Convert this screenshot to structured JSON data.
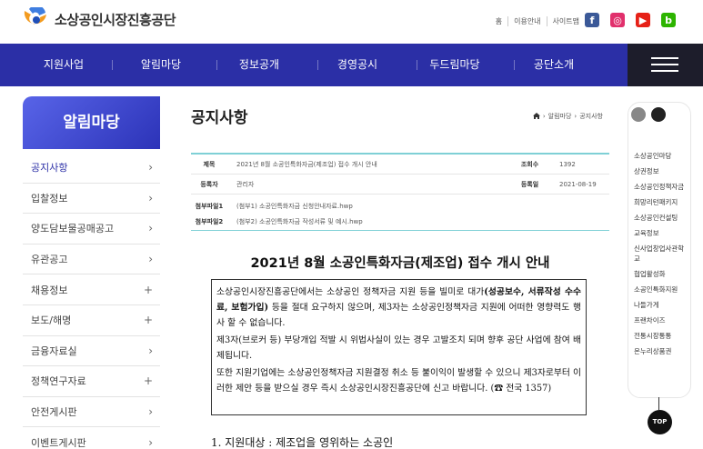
{
  "header": {
    "org_name": "소상공인시장진흥공단",
    "utils": [
      "홈",
      "이용안내",
      "사이트맵"
    ],
    "sns": [
      {
        "name": "facebook",
        "color": "#3b5998",
        "glyph": "f"
      },
      {
        "name": "instagram",
        "color": "#e1306c",
        "glyph": "◎"
      },
      {
        "name": "youtube",
        "color": "#e62117",
        "glyph": "▶"
      },
      {
        "name": "blog",
        "color": "#2db400",
        "glyph": "b"
      }
    ]
  },
  "gnb": {
    "items": [
      "지원사업",
      "알림마당",
      "정보공개",
      "경영공시",
      "두드림마당",
      "공단소개"
    ],
    "menu_icon": "hamburger-icon"
  },
  "lnb": {
    "title": "알림마당",
    "items": [
      {
        "label": "공지사항",
        "mark": "›",
        "active": true
      },
      {
        "label": "입찰정보",
        "mark": "›"
      },
      {
        "label": "양도담보물공매공고",
        "mark": "›"
      },
      {
        "label": "유관공고",
        "mark": "›"
      },
      {
        "label": "채용정보",
        "mark": "+"
      },
      {
        "label": "보도/해명",
        "mark": "+"
      },
      {
        "label": "금융자료실",
        "mark": "›"
      },
      {
        "label": "정책연구자료",
        "mark": "+"
      },
      {
        "label": "안전게시판",
        "mark": "›"
      },
      {
        "label": "이벤트게시판",
        "mark": "›"
      }
    ]
  },
  "main": {
    "page_title": "공지사항",
    "breadcrumb": [
      "알림마당",
      "공지사항"
    ],
    "post": {
      "subject_label": "제목",
      "subject": "2021년 8월 소공인특화자금(제조업) 접수 개시 안내",
      "views_label": "조회수",
      "views": "1392",
      "author_label": "등록자",
      "author": "관리자",
      "date_label": "등록일",
      "date": "2021-08-19",
      "files": [
        {
          "label": "첨부파일1",
          "name": "(첨부1) 소공인특화자금 신청안내자료.hwp"
        },
        {
          "label": "첨부파일2",
          "name": "(첨부2) 소공인특화자금 작성서류 및 예시.hwp"
        }
      ]
    },
    "doc_title": "2021년 8월 소공인특화자금(제조업) 접수 개시 안내",
    "notice": {
      "p1_a": "소상공인시장진흥공단에서는 소상공인 정책자금 지원 등을 빌미로 대가",
      "p1_b": "(성공보수, 서류작성 수수료, 보험가입)",
      "p1_c": " 등을 절대 요구하지 않으며, 제3자는 소상공인정책자금 지원에 어떠한 영향력도 행사 할 수 없습니다.",
      "p2": "제3자(브로커 등) 부당개입 적발 시 위법사실이 있는 경우 고발조치 되며 향후 공단 사업에 참여 배제됩니다.",
      "p3": "또한 지원기업에는 소상공인정책자금 지원결정 취소 등 불이익이 발생할 수 있으니 제3자로부터 이러한 제안 등을 받으실 경우 즉시 소상공인시장진흥공단에 신고 바랍니다. (☎ 전국 1357)"
    },
    "section_1": "1. 지원대상 : 제조업을 영위하는 소공인"
  },
  "quick": {
    "items": [
      "소상공인마당",
      "상권정보",
      "소상공인정책자금",
      "희망리턴패키지",
      "소상공인컨설팅",
      "교육정보",
      "신사업창업사관학교",
      "협업활성화",
      "소공인특화지원",
      "나들가게",
      "프랜차이즈",
      "전통시장통통",
      "온누리상품권"
    ],
    "top_label": "TOP"
  }
}
